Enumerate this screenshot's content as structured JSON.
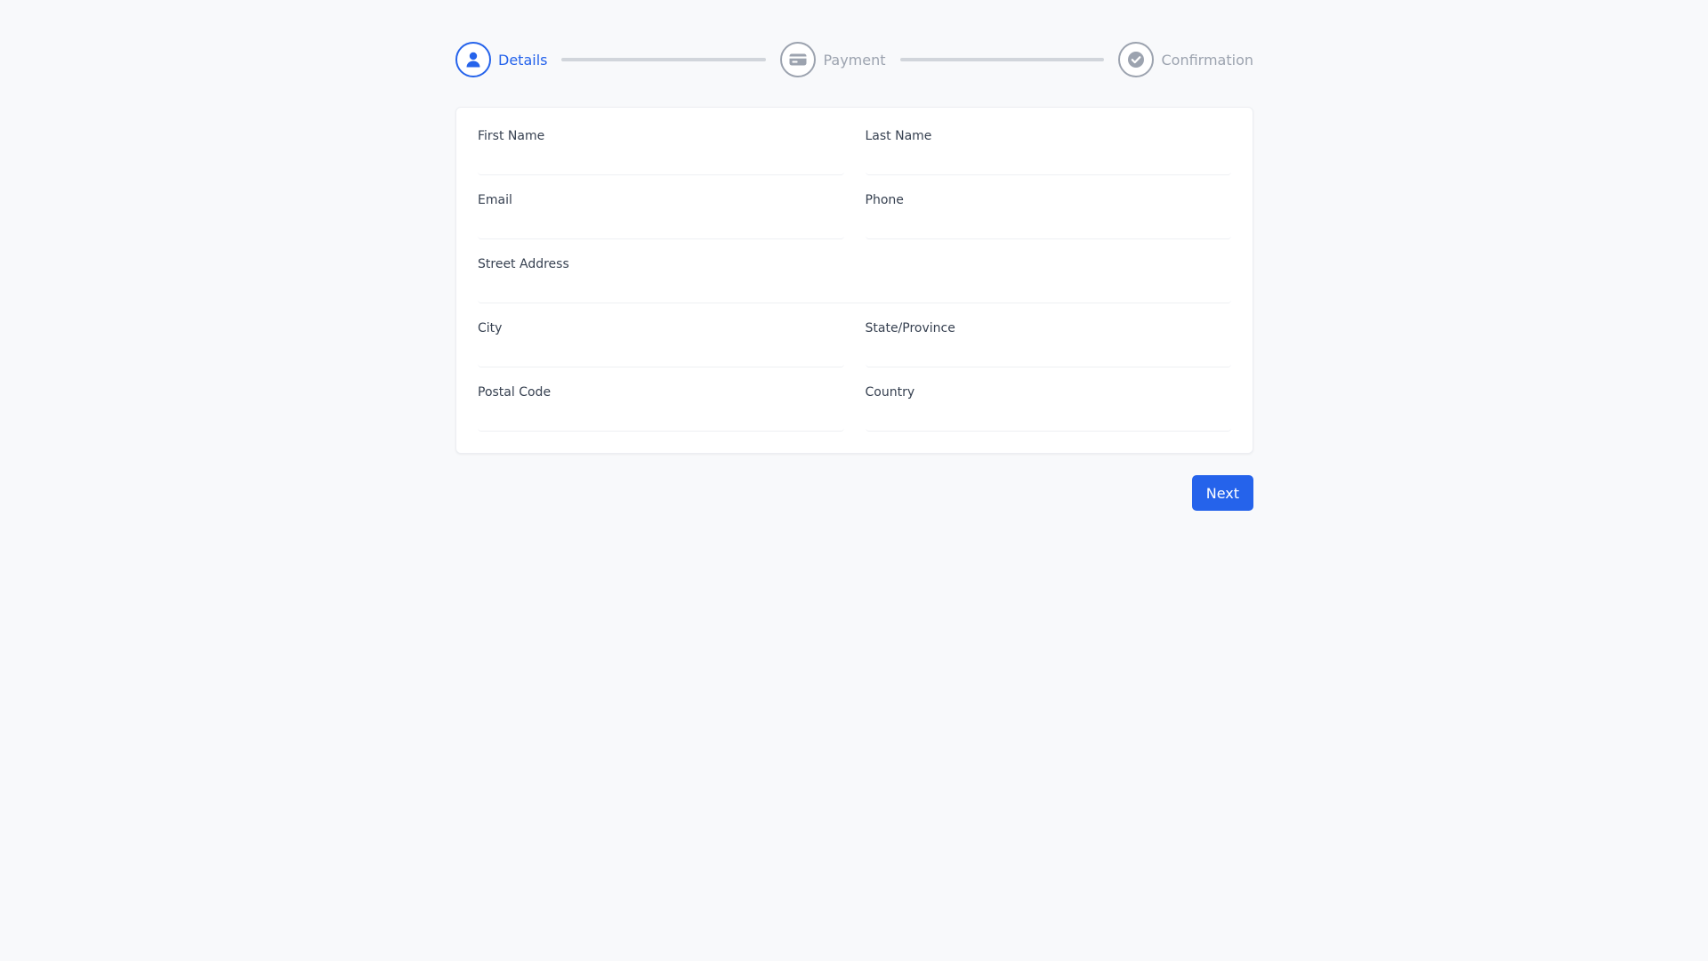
{
  "stepper": {
    "steps": [
      {
        "label": "Details",
        "icon": "user-icon",
        "state": "active"
      },
      {
        "label": "Payment",
        "icon": "credit-card-icon",
        "state": "inactive"
      },
      {
        "label": "Confirmation",
        "icon": "check-circle-icon",
        "state": "inactive"
      }
    ]
  },
  "form": {
    "first_name": {
      "label": "First Name",
      "value": ""
    },
    "last_name": {
      "label": "Last Name",
      "value": ""
    },
    "email": {
      "label": "Email",
      "value": ""
    },
    "phone": {
      "label": "Phone",
      "value": ""
    },
    "street_address": {
      "label": "Street Address",
      "value": ""
    },
    "city": {
      "label": "City",
      "value": ""
    },
    "state_province": {
      "label": "State/Province",
      "value": ""
    },
    "postal_code": {
      "label": "Postal Code",
      "value": ""
    },
    "country": {
      "label": "Country",
      "value": ""
    }
  },
  "actions": {
    "next_label": "Next"
  },
  "colors": {
    "accent": "#2563eb",
    "inactive": "#9ca3af",
    "connector": "#d1d5db",
    "background": "#f8f9fb"
  }
}
